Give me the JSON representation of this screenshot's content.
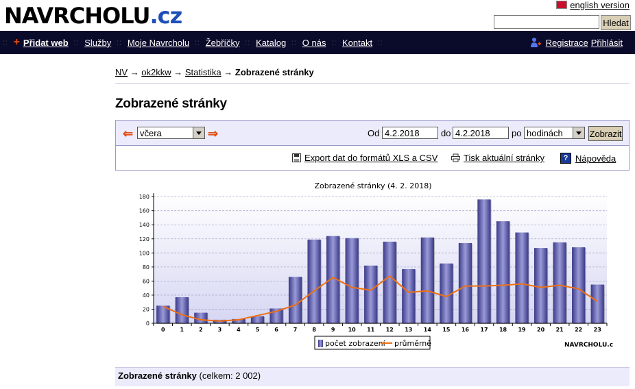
{
  "logo": {
    "main": "NAVRCHOLU",
    "suffix": ".cz"
  },
  "header": {
    "lang_link": "english version",
    "search_placeholder": "",
    "search_button": "Hledat"
  },
  "nav": {
    "items": [
      "Přidat web",
      "Služby",
      "Moje Navrcholu",
      "Žebříčky",
      "Katalog",
      "O nás",
      "Kontakt"
    ],
    "register": "Registrace",
    "login": "Přihlásit"
  },
  "breadcrumb": {
    "items": [
      "NV",
      "ok2kkw",
      "Statistika"
    ],
    "current": "Zobrazené stránky"
  },
  "page_title": "Zobrazené stránky",
  "filter": {
    "period": "včera",
    "from_label": "Od",
    "from_value": "4.2.2018",
    "to_label": "do",
    "to_value": "4.2.2018",
    "by_label": "po",
    "by_value": "hodinách",
    "submit": "Zobrazit"
  },
  "tools": {
    "export": "Export dat do formátů XLS a CSV",
    "print": "Tisk aktuální stránky",
    "help": "Nápověda"
  },
  "chart_data": {
    "type": "bar",
    "title": "Zobrazené stránky (4. 2. 2018)",
    "categories": [
      "0",
      "1",
      "2",
      "3",
      "4",
      "5",
      "6",
      "7",
      "8",
      "9",
      "10",
      "11",
      "12",
      "13",
      "14",
      "15",
      "16",
      "17",
      "18",
      "19",
      "20",
      "21",
      "22",
      "23"
    ],
    "series": [
      {
        "name": "počet zobrazení",
        "type": "bar",
        "color": "#5a5aa8",
        "values": [
          25,
          37,
          15,
          5,
          6,
          10,
          21,
          66,
          119,
          124,
          121,
          82,
          116,
          77,
          122,
          85,
          114,
          176,
          145,
          129,
          107,
          115,
          108,
          55
        ]
      },
      {
        "name": "průměrně",
        "type": "line",
        "color": "#f07010",
        "values": [
          24,
          12,
          5,
          3,
          5,
          11,
          17,
          26,
          46,
          65,
          51,
          47,
          67,
          44,
          46,
          38,
          53,
          53,
          54,
          56,
          51,
          54,
          49,
          31
        ]
      }
    ],
    "yticks": [
      0,
      20,
      40,
      60,
      80,
      100,
      120,
      140,
      160,
      180
    ],
    "ylim": [
      0,
      185
    ],
    "grid": true,
    "legend": "bottom-center",
    "watermark": "NAVRCHOLU.cz"
  },
  "summary": {
    "label": "Zobrazené stránky",
    "detail": "(celkem: 2 002)"
  }
}
